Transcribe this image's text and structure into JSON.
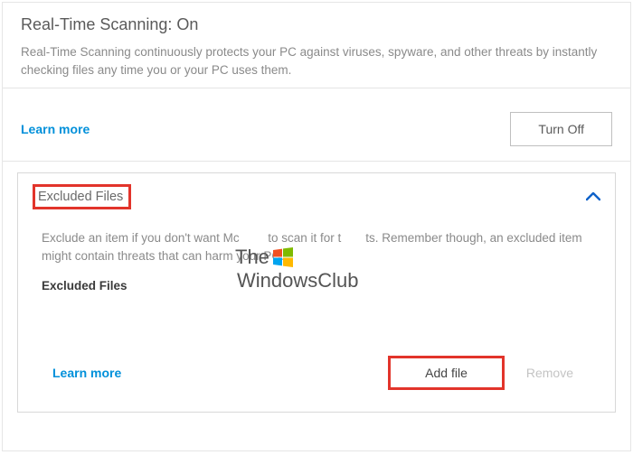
{
  "header": {
    "title": "Real-Time Scanning: On",
    "description": "Real-Time Scanning continuously protects your PC against viruses, spyware, and other threats by instantly checking files any time you or your PC uses them."
  },
  "actions": {
    "learn_more": "Learn more",
    "turn_off": "Turn Off"
  },
  "panel": {
    "header_label": "Excluded Files",
    "description_part1": "Exclude an item if you don't want Mc",
    "description_part2": "to scan it for t",
    "description_part3": "ts. Remember though, an excluded item might contain threats that can harm your PC.",
    "list_label": "Excluded Files",
    "learn_more": "Learn more",
    "add_file": "Add file",
    "remove": "Remove"
  },
  "watermark": {
    "prefix": "The",
    "suffix": "WindowsClub"
  }
}
